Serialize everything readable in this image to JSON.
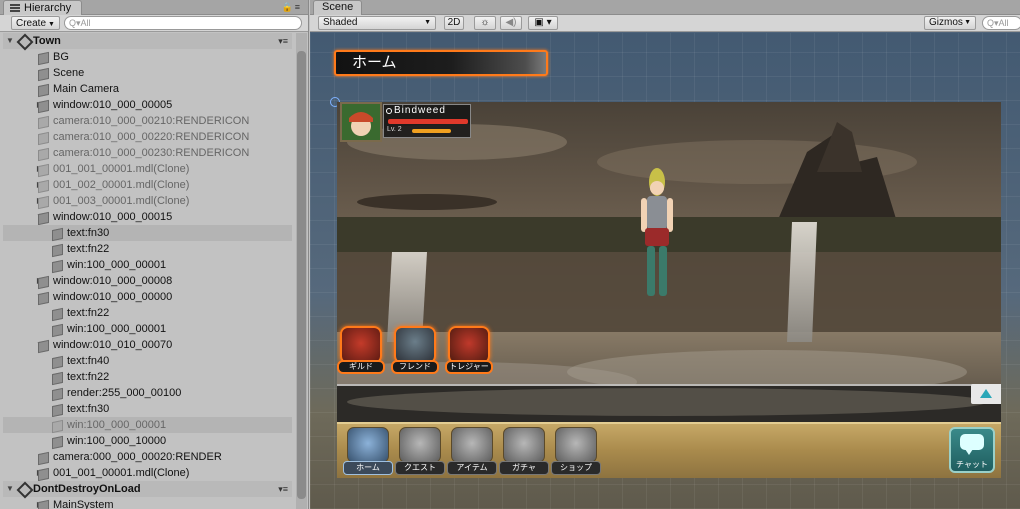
{
  "hierarchy": {
    "tab_title": "Hierarchy",
    "create_label": "Create",
    "search_placeholder": "All",
    "rows": [
      {
        "label": "Town",
        "type": "scene",
        "depth": 0,
        "expanded": true
      },
      {
        "label": "BG",
        "type": "obj",
        "depth": 1
      },
      {
        "label": "Scene",
        "type": "obj",
        "depth": 1
      },
      {
        "label": "Main Camera",
        "type": "obj",
        "depth": 1
      },
      {
        "label": "window:010_000_00005",
        "type": "obj",
        "depth": 1,
        "collapsed": true
      },
      {
        "label": "camera:010_000_00210:RENDERICON",
        "type": "obj",
        "depth": 1,
        "dim": true
      },
      {
        "label": "camera:010_000_00220:RENDERICON",
        "type": "obj",
        "depth": 1,
        "dim": true
      },
      {
        "label": "camera:010_000_00230:RENDERICON",
        "type": "obj",
        "depth": 1,
        "dim": true
      },
      {
        "label": "001_001_00001.mdl(Clone)",
        "type": "obj",
        "depth": 1,
        "dim": true,
        "collapsed": true
      },
      {
        "label": "001_002_00001.mdl(Clone)",
        "type": "obj",
        "depth": 1,
        "dim": true,
        "collapsed": true
      },
      {
        "label": "001_003_00001.mdl(Clone)",
        "type": "obj",
        "depth": 1,
        "dim": true,
        "collapsed": true
      },
      {
        "label": "window:010_000_00015",
        "type": "obj",
        "depth": 1,
        "expanded": true
      },
      {
        "label": "text:fn30",
        "type": "obj",
        "depth": 2,
        "highlight": true
      },
      {
        "label": "text:fn22",
        "type": "obj",
        "depth": 2
      },
      {
        "label": "win:100_000_00001",
        "type": "obj",
        "depth": 2
      },
      {
        "label": "window:010_000_00008",
        "type": "obj",
        "depth": 1,
        "collapsed": true
      },
      {
        "label": "window:010_000_00000",
        "type": "obj",
        "depth": 1,
        "expanded": true
      },
      {
        "label": "text:fn22",
        "type": "obj",
        "depth": 2
      },
      {
        "label": "win:100_000_00001",
        "type": "obj",
        "depth": 2
      },
      {
        "label": "window:010_010_00070",
        "type": "obj",
        "depth": 1,
        "expanded": true
      },
      {
        "label": "text:fn40",
        "type": "obj",
        "depth": 2
      },
      {
        "label": "text:fn22",
        "type": "obj",
        "depth": 2
      },
      {
        "label": "render:255_000_00100",
        "type": "obj",
        "depth": 2
      },
      {
        "label": "text:fn30",
        "type": "obj",
        "depth": 2
      },
      {
        "label": "win:100_000_00001",
        "type": "obj",
        "depth": 2,
        "dim": true,
        "selected": true
      },
      {
        "label": "win:100_000_10000",
        "type": "obj",
        "depth": 2
      },
      {
        "label": "camera:000_000_00020:RENDER",
        "type": "obj",
        "depth": 1
      },
      {
        "label": "001_001_00001.mdl(Clone)",
        "type": "obj",
        "depth": 1,
        "collapsed": true
      },
      {
        "label": "DontDestroyOnLoad",
        "type": "scene",
        "depth": 0,
        "expanded": true
      },
      {
        "label": "MainSystem",
        "type": "obj",
        "depth": 1,
        "collapsed": true
      }
    ]
  },
  "scene": {
    "tab_title": "Scene",
    "shading_mode": "Shaded",
    "mode_2d": "2D",
    "gizmos_label": "Gizmos",
    "search_placeholder": "All"
  },
  "game": {
    "page_title": "ホーム",
    "player": {
      "name": "Bindweed",
      "level": "Lv. 2",
      "hp": 1.0,
      "xp": 0.7
    },
    "side_buttons": [
      {
        "label": "ギルド",
        "icon": "guild-icon"
      },
      {
        "label": "フレンド",
        "icon": "friends-icon"
      },
      {
        "label": "トレジャー",
        "icon": "treasure-chest-icon"
      }
    ],
    "nav_buttons": [
      {
        "label": "ホーム",
        "icon": "home-castle-icon",
        "active": true
      },
      {
        "label": "クエスト",
        "icon": "quest-map-icon"
      },
      {
        "label": "アイテム",
        "icon": "item-bag-icon"
      },
      {
        "label": "ガチャ",
        "icon": "gacha-book-icon"
      },
      {
        "label": "ショップ",
        "icon": "shop-coin-icon"
      }
    ],
    "chat_label": "チャット"
  },
  "colors": {
    "highlight_orange": "#ff7a1a",
    "hp_red": "#e0392b",
    "xp_orange": "#f0a020",
    "scene_bg": "#4d6279",
    "panel_bg": "#c2c2c2"
  }
}
